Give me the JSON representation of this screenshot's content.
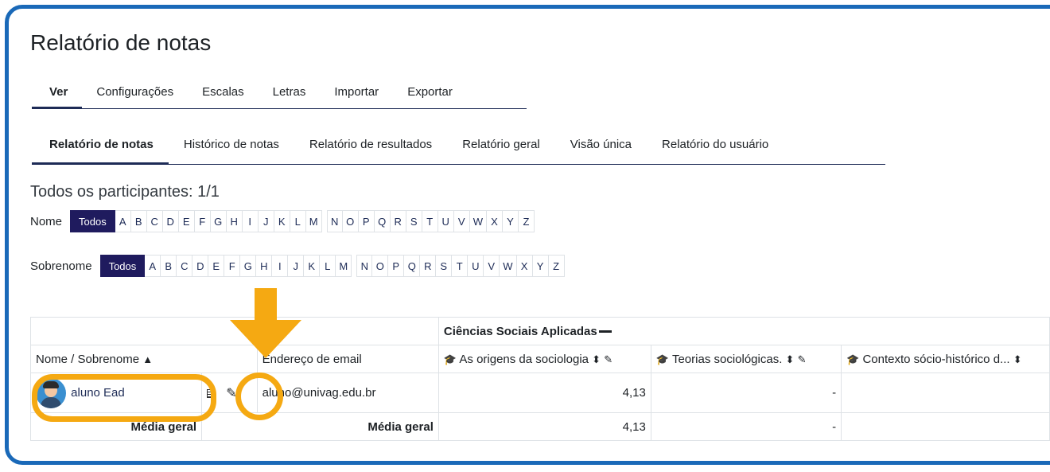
{
  "page": {
    "title": "Relatório de notas"
  },
  "primary_tabs": [
    {
      "label": "Ver",
      "active": true
    },
    {
      "label": "Configurações",
      "active": false
    },
    {
      "label": "Escalas",
      "active": false
    },
    {
      "label": "Letras",
      "active": false
    },
    {
      "label": "Importar",
      "active": false
    },
    {
      "label": "Exportar",
      "active": false
    }
  ],
  "secondary_tabs": [
    {
      "label": "Relatório de notas",
      "active": true
    },
    {
      "label": "Histórico de notas",
      "active": false
    },
    {
      "label": "Relatório de resultados",
      "active": false
    },
    {
      "label": "Relatório geral",
      "active": false
    },
    {
      "label": "Visão única",
      "active": false
    },
    {
      "label": "Relatório do usuário",
      "active": false
    }
  ],
  "participants": {
    "text": "Todos os participantes: 1/1"
  },
  "filters": {
    "first_name": {
      "label": "Nome",
      "all": "Todos"
    },
    "last_name": {
      "label": "Sobrenome",
      "all": "Todos"
    },
    "letters": [
      "A",
      "B",
      "C",
      "D",
      "E",
      "F",
      "G",
      "H",
      "I",
      "J",
      "K",
      "L",
      "M",
      "N",
      "O",
      "P",
      "Q",
      "R",
      "S",
      "T",
      "U",
      "V",
      "W",
      "X",
      "Y",
      "Z"
    ]
  },
  "table": {
    "category_header": "Ciências Sociais Aplicadas",
    "col_name": "Nome / Sobrenome",
    "col_email": "Endereço de email",
    "items": [
      "As origens da sociologia",
      "Teorias sociológicas.",
      "Contexto sócio-histórico d..."
    ],
    "row": {
      "name": "aluno Ead",
      "email": "aluno@univag.edu.br",
      "grades": [
        "4,13",
        "-",
        ""
      ]
    },
    "average": {
      "label1": "Média geral",
      "label2": "Média geral",
      "grades": [
        "4,13",
        "-",
        ""
      ]
    }
  },
  "colors": {
    "frame": "#1a69b8",
    "highlight": "#f5a912",
    "selected_filter": "#1f1b5e"
  },
  "icons": [
    "sort-asc-icon",
    "graduation-cap-icon",
    "sort-icon",
    "edit-icon",
    "collapse-icon",
    "single-view-icon",
    "avatar"
  ]
}
